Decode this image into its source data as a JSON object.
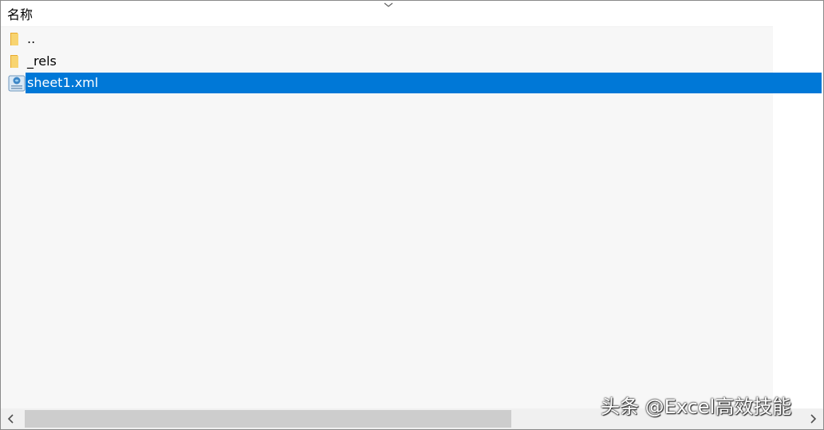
{
  "header": {
    "name_column": "名称",
    "sort_icon": "chevron-down-icon"
  },
  "files": [
    {
      "name": "..",
      "icon": "folder-icon",
      "selected": false
    },
    {
      "name": "_rels",
      "icon": "folder-icon",
      "selected": false
    },
    {
      "name": "sheet1.xml",
      "icon": "xml-file-icon",
      "selected": true
    }
  ],
  "scrollbar": {
    "left_icon": "chevron-left-icon",
    "right_icon": "chevron-right-icon"
  },
  "watermark": {
    "text": "头条 @Excel高效技能"
  },
  "colors": {
    "selection": "#0078d7",
    "list_background": "#f7f7f7",
    "folder": "#f5c24a",
    "scroll_thumb": "#cdcdcd"
  }
}
